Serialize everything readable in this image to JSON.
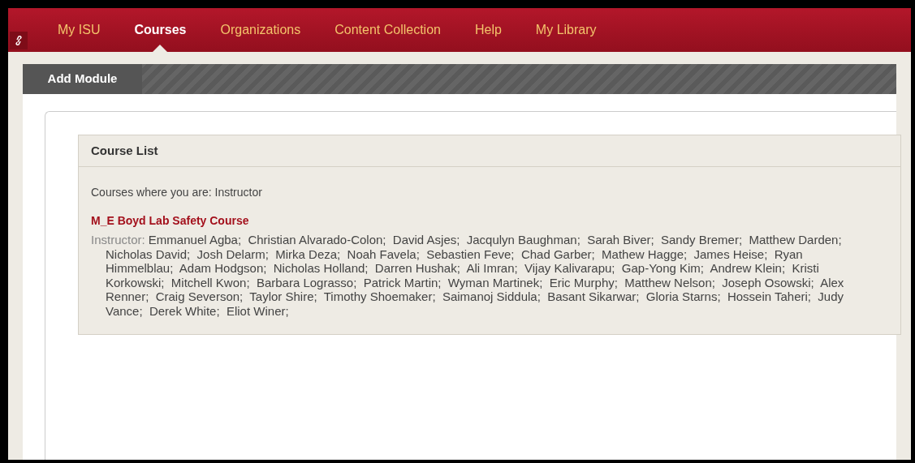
{
  "nav": {
    "tabs": [
      {
        "label": "My ISU",
        "selected": false
      },
      {
        "label": "Courses",
        "selected": true
      },
      {
        "label": "Organizations",
        "selected": false
      },
      {
        "label": "Content Collection",
        "selected": false
      },
      {
        "label": "Help",
        "selected": false
      },
      {
        "label": "My Library",
        "selected": false
      }
    ]
  },
  "toolbar": {
    "button": "Add Module"
  },
  "module": {
    "title": "Course List",
    "role_line": "Courses where you are: Instructor",
    "courses": [
      {
        "name": "M_E Boyd Lab Safety Course",
        "instructor_label": "Instructor:",
        "instructors": "Emmanuel Agba;  Christian Alvarado-Colon;  David Asjes;  Jacqulyn Baughman;  Sarah Biver;  Sandy Bremer;  Matthew Darden;  Nicholas David;  Josh Delarm;  Mirka Deza;  Noah Favela;  Sebastien Feve;  Chad Garber;  Mathew Hagge;  James Heise;  Ryan Himmelblau;  Adam Hodgson;  Nicholas Holland;  Darren Hushak;  Ali Imran;  Vijay Kalivarapu;  Gap-Yong Kim;  Andrew Klein;  Kristi Korkowski;  Mitchell Kwon;  Barbara Lograsso;  Patrick Martin;  Wyman Martinek;  Eric Murphy;  Matthew Nelson;  Joseph Osowski;  Alex Renner;  Craig Severson;  Taylor Shire;  Timothy Shoemaker;  Saimanoj Siddula;  Basant Sikarwar;  Gloria Starns;  Hossein Taheri;  Judy Vance;  Derek White;  Eliot Winer;"
      }
    ]
  }
}
